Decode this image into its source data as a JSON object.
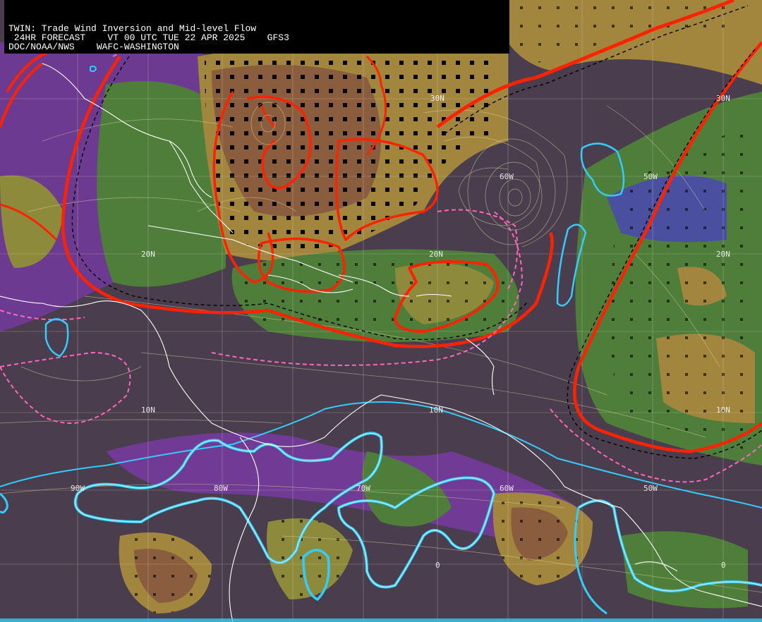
{
  "header": {
    "line1": "TWIN: Trade Wind Inversion and Mid-level Flow",
    "line2": " 24HR FORECAST    VT 00 UTC TUE 22 APR 2025    GFS3",
    "line3": "DOC/NOAA/NWS    WAFC-WASHINGTON"
  },
  "grid_labels": {
    "lat30_a": "30N",
    "lat30_b": "30N",
    "lat20_a": "20N",
    "lat20_b": "20N",
    "lat20_c": "20N",
    "lat10_a": "10N",
    "lat10_b": "10N",
    "lat10_c": "10N",
    "lon90": "90W",
    "lon80": "80W",
    "lon70": "70W",
    "lon60_a": "60W",
    "lon60_b": "60W",
    "lon50_a": "50W",
    "lon50_b": "50W",
    "eq_a": "0",
    "eq_b": "0"
  },
  "colors": {
    "background": "#4a3e4e",
    "purple": "#7a3aa8",
    "blue": "#4a4fa0",
    "green": "#4f7d3a",
    "olive": "#8d8a3c",
    "tan": "#a3863e",
    "brown": "#8a5d3e",
    "red_contour": "#ff2200",
    "cyan_contour": "#33ccff",
    "pink_dash": "#ff66bb"
  }
}
